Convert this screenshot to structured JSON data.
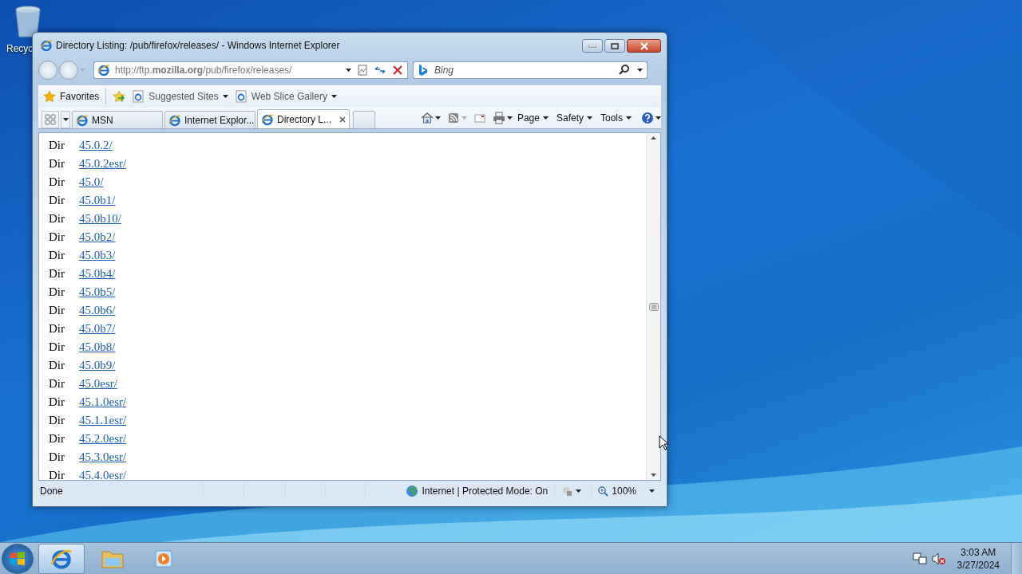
{
  "desktop": {
    "icons": [
      {
        "label": "Recyc"
      }
    ]
  },
  "window": {
    "title": "Directory Listing: /pub/firefox/releases/ - Windows Internet Explorer"
  },
  "address_bar": {
    "url": "http://ftp.**mozilla.org**/pub/firefox/releases/"
  },
  "search": {
    "placeholder": "Bing"
  },
  "favorites_bar": {
    "items": [
      {
        "label": "Favorites",
        "kind": "favorites"
      },
      {
        "label": "Suggested Sites",
        "kind": "page"
      },
      {
        "label": "Web Slice Gallery",
        "kind": "page"
      }
    ]
  },
  "tabs": [
    {
      "label": "MSN",
      "selected": false
    },
    {
      "label": "Internet Explor...",
      "selected": false
    },
    {
      "label": "Directory L...",
      "selected": true
    }
  ],
  "command_bar": {
    "menus": [
      "Page",
      "Safety",
      "Tools"
    ]
  },
  "listing": [
    {
      "type": "Dir",
      "name": "45.0.2/"
    },
    {
      "type": "Dir",
      "name": "45.0.2esr/"
    },
    {
      "type": "Dir",
      "name": "45.0/"
    },
    {
      "type": "Dir",
      "name": "45.0b1/"
    },
    {
      "type": "Dir",
      "name": "45.0b10/"
    },
    {
      "type": "Dir",
      "name": "45.0b2/"
    },
    {
      "type": "Dir",
      "name": "45.0b3/"
    },
    {
      "type": "Dir",
      "name": "45.0b4/"
    },
    {
      "type": "Dir",
      "name": "45.0b5/"
    },
    {
      "type": "Dir",
      "name": "45.0b6/"
    },
    {
      "type": "Dir",
      "name": "45.0b7/"
    },
    {
      "type": "Dir",
      "name": "45.0b8/"
    },
    {
      "type": "Dir",
      "name": "45.0b9/"
    },
    {
      "type": "Dir",
      "name": "45.0esr/"
    },
    {
      "type": "Dir",
      "name": "45.1.0esr/"
    },
    {
      "type": "Dir",
      "name": "45.1.1esr/"
    },
    {
      "type": "Dir",
      "name": "45.2.0esr/"
    },
    {
      "type": "Dir",
      "name": "45.3.0esr/"
    },
    {
      "type": "Dir",
      "name": "45.4.0esr/"
    }
  ],
  "status_bar": {
    "status": "Done",
    "zone": "Internet | Protected Mode: On",
    "zoom": "100%"
  },
  "taskbar": {
    "time": "3:03 AM",
    "date": "3/27/2024"
  }
}
